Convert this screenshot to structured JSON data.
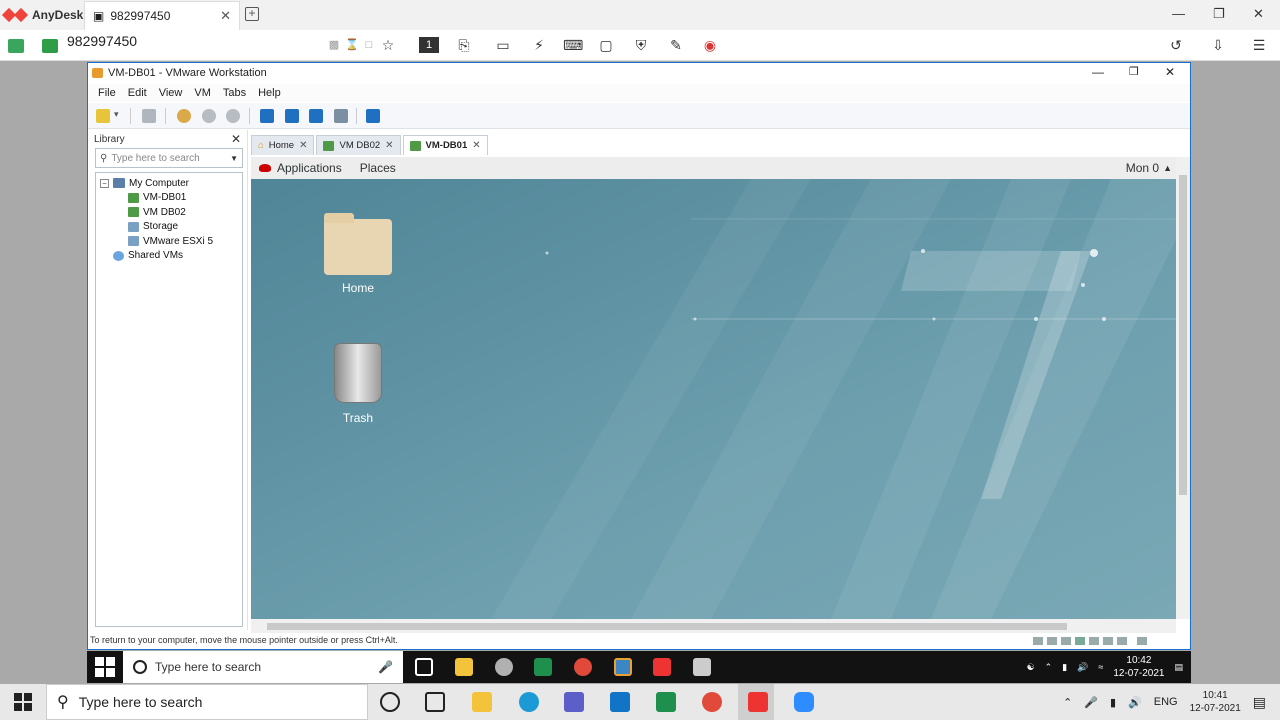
{
  "anydesk": {
    "app_name": "AnyDesk",
    "tab_title": "982997450",
    "address": "982997450"
  },
  "vmware": {
    "window_title": "VM-DB01 - VMware Workstation",
    "menu": [
      "File",
      "Edit",
      "View",
      "VM",
      "Tabs",
      "Help"
    ],
    "library": {
      "title": "Library",
      "search_placeholder": "Type here to search",
      "tree": [
        {
          "label": "My Computer",
          "type": "computer",
          "level": 0
        },
        {
          "label": "VM-DB01",
          "type": "vm",
          "level": 1
        },
        {
          "label": "VM DB02",
          "type": "vm",
          "level": 1
        },
        {
          "label": "Storage",
          "type": "vm",
          "level": 1
        },
        {
          "label": "VMware ESXi 5",
          "type": "vm",
          "level": 1
        },
        {
          "label": "Shared VMs",
          "type": "shared",
          "level": 0
        }
      ]
    },
    "tabs": [
      {
        "label": "Home",
        "active": false
      },
      {
        "label": "VM DB02",
        "active": false
      },
      {
        "label": "VM-DB01",
        "active": true
      }
    ],
    "guest": {
      "topbar": {
        "applications": "Applications",
        "places": "Places",
        "clock": "Mon 0"
      },
      "desktop_icons": [
        {
          "label": "Home",
          "kind": "folder"
        },
        {
          "label": "Trash",
          "kind": "trash"
        }
      ]
    },
    "status_text": "To return to your computer, move the mouse pointer outside or press Ctrl+Alt."
  },
  "guest_taskbar": {
    "search_placeholder": "Type here to search",
    "time": "10:42",
    "date": "12-07-2021"
  },
  "host_taskbar": {
    "search_placeholder": "Type here to search",
    "language": "ENG",
    "time": "10:41",
    "date": "12-07-2021"
  },
  "colors": {
    "anydesk_red": "#ef443b",
    "vmware_border": "#1a6fc9",
    "guest_desktop": "#5b8fa2"
  }
}
